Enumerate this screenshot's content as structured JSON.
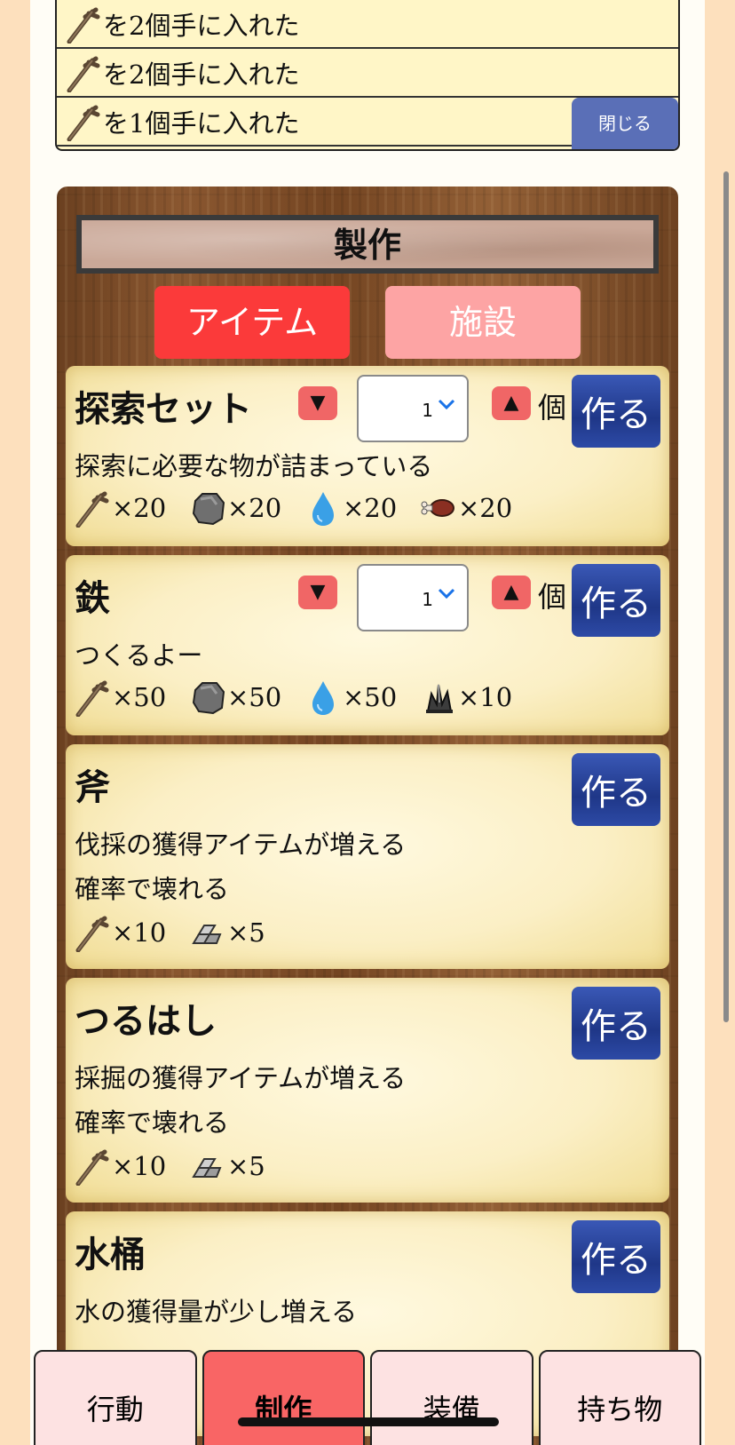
{
  "log": {
    "rows": [
      {
        "text": "を2個手に入れた",
        "icon": "stick-icon"
      },
      {
        "text": "を2個手に入れた",
        "icon": "stick-icon"
      },
      {
        "text": "を1個手に入れた",
        "icon": "stick-icon"
      }
    ],
    "close_label": "閉じる"
  },
  "craft": {
    "title": "製作",
    "tabs": {
      "item": "アイテム",
      "facility": "施設"
    },
    "make_label": "作る",
    "unit_label": "個",
    "down_symbol": "▼",
    "up_symbol": "▲",
    "recipes": [
      {
        "name": "探索セット",
        "quantity": "1",
        "desc": [
          "探索に必要な物が詰まっている"
        ],
        "materials": [
          {
            "icon": "stick-icon",
            "amount": "×20"
          },
          {
            "icon": "stone-icon",
            "amount": "×20"
          },
          {
            "icon": "water-drop-icon",
            "amount": "×20"
          },
          {
            "icon": "meat-icon",
            "amount": "×20"
          }
        ]
      },
      {
        "name": "鉄",
        "quantity": "1",
        "desc": [
          "つくるよー"
        ],
        "materials": [
          {
            "icon": "stick-icon",
            "amount": "×50"
          },
          {
            "icon": "stone-icon",
            "amount": "×50"
          },
          {
            "icon": "water-drop-icon",
            "amount": "×50"
          },
          {
            "icon": "crystal-icon",
            "amount": "×10"
          }
        ]
      },
      {
        "name": "斧",
        "desc": [
          "伐採の獲得アイテムが増える",
          "確率で壊れる"
        ],
        "materials": [
          {
            "icon": "stick-icon",
            "amount": "×10"
          },
          {
            "icon": "iron-ingot-icon",
            "amount": "×5"
          }
        ]
      },
      {
        "name": "つるはし",
        "desc": [
          "採掘の獲得アイテムが増える",
          "確率で壊れる"
        ],
        "materials": [
          {
            "icon": "stick-icon",
            "amount": "×10"
          },
          {
            "icon": "iron-ingot-icon",
            "amount": "×5"
          }
        ]
      },
      {
        "name": "水桶",
        "desc": [
          "水の獲得量が少し増える"
        ]
      }
    ]
  },
  "nav": {
    "items": [
      "行動",
      "制作",
      "装備",
      "持ち物"
    ],
    "active": "制作"
  },
  "colors": {
    "active_tab": "#fb3a3a",
    "inactive_tab": "#fda4a4",
    "make_button": "#2d4aa6",
    "nav_active": "#f96565",
    "nav_inactive": "#fde2e2"
  }
}
